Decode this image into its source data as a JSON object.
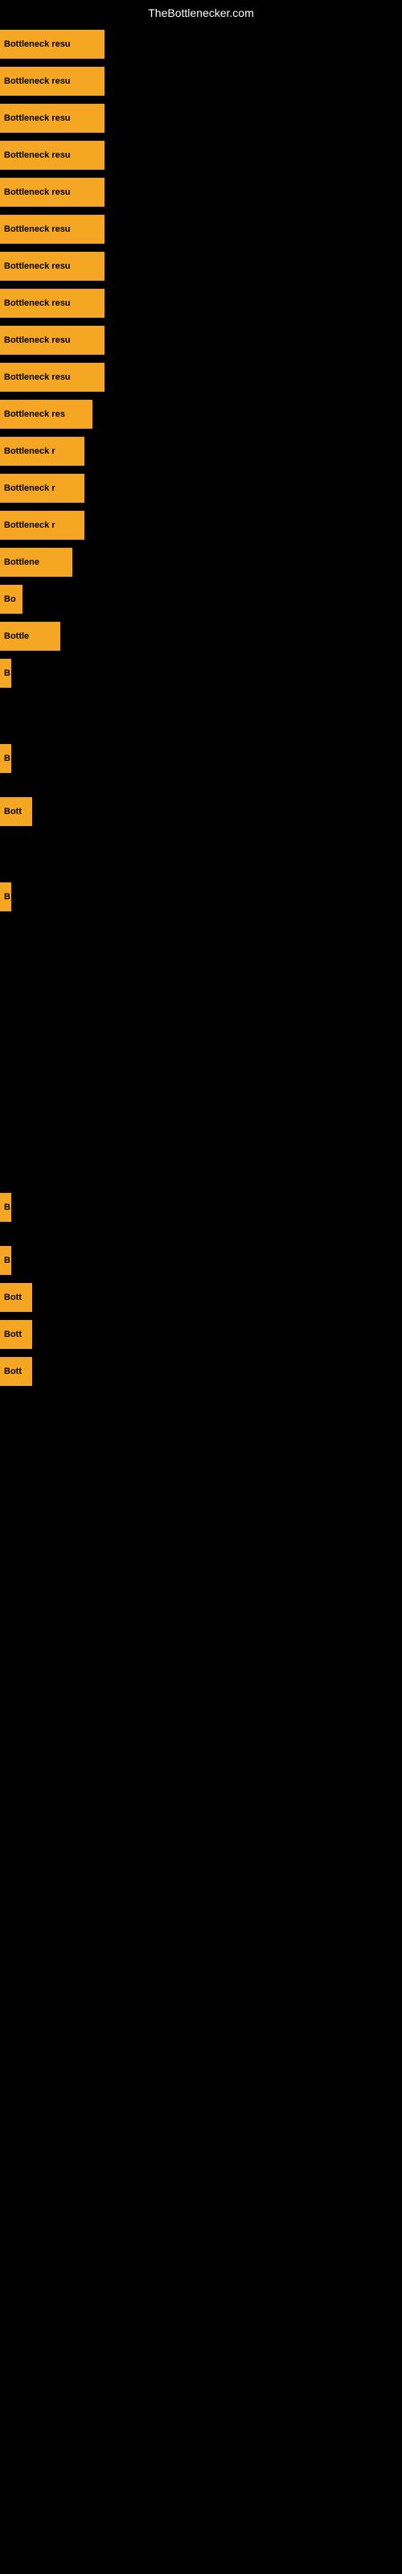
{
  "site": {
    "title": "TheBottlenecker.com"
  },
  "bars": [
    {
      "id": 1,
      "label": "Bottleneck resu",
      "row_class": "row-1"
    },
    {
      "id": 2,
      "label": "Bottleneck resu",
      "row_class": "row-2"
    },
    {
      "id": 3,
      "label": "Bottleneck resu",
      "row_class": "row-3"
    },
    {
      "id": 4,
      "label": "Bottleneck resu",
      "row_class": "row-4"
    },
    {
      "id": 5,
      "label": "Bottleneck resu",
      "row_class": "row-5"
    },
    {
      "id": 6,
      "label": "Bottleneck resu",
      "row_class": "row-6"
    },
    {
      "id": 7,
      "label": "Bottleneck resu",
      "row_class": "row-7"
    },
    {
      "id": 8,
      "label": "Bottleneck resu",
      "row_class": "row-8"
    },
    {
      "id": 9,
      "label": "Bottleneck resu",
      "row_class": "row-9"
    },
    {
      "id": 10,
      "label": "Bottleneck resu",
      "row_class": "row-10"
    },
    {
      "id": 11,
      "label": "Bottleneck res",
      "row_class": "row-11"
    },
    {
      "id": 12,
      "label": "Bottleneck r",
      "row_class": "row-12"
    },
    {
      "id": 13,
      "label": "Bottleneck r",
      "row_class": "row-13"
    },
    {
      "id": 14,
      "label": "Bottleneck r",
      "row_class": "row-14"
    },
    {
      "id": 15,
      "label": "Bottlene",
      "row_class": "row-15"
    },
    {
      "id": 16,
      "label": "Bo",
      "row_class": "row-16"
    },
    {
      "id": 17,
      "label": "Bottle",
      "row_class": "row-17"
    },
    {
      "id": 18,
      "label": "B",
      "row_class": "row-18"
    }
  ],
  "sparse_bars": [
    {
      "id": 20,
      "label": "B",
      "row_class": "row-20"
    },
    {
      "id": 22,
      "label": "Bott",
      "row_class": "row-22"
    },
    {
      "id": 24,
      "label": "B",
      "row_class": "row-24"
    },
    {
      "id": 25,
      "label": "B",
      "row_class": "row-25"
    },
    {
      "id": 27,
      "label": "B",
      "row_class": "row-27"
    },
    {
      "id": 28,
      "label": "Bott",
      "row_class": "row-28"
    },
    {
      "id": 29,
      "label": "Bott",
      "row_class": "row-29"
    },
    {
      "id": 30,
      "label": "Bott",
      "row_class": "row-30"
    }
  ]
}
